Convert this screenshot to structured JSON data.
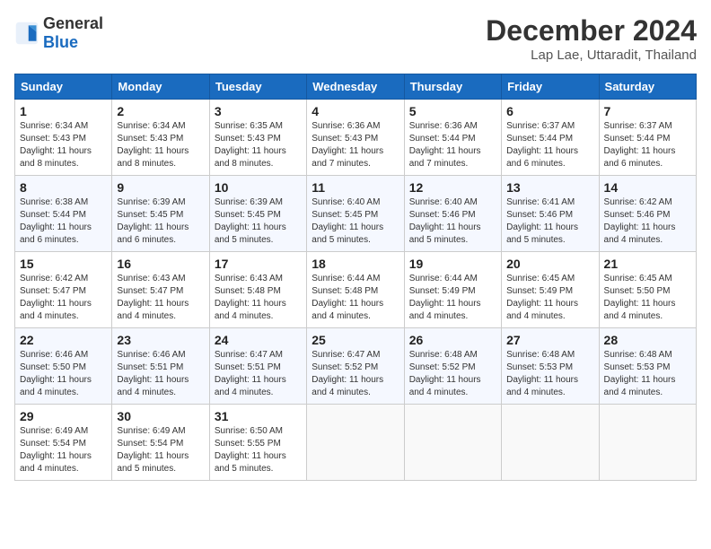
{
  "header": {
    "logo_general": "General",
    "logo_blue": "Blue",
    "month_title": "December 2024",
    "location": "Lap Lae, Uttaradit, Thailand"
  },
  "days_of_week": [
    "Sunday",
    "Monday",
    "Tuesday",
    "Wednesday",
    "Thursday",
    "Friday",
    "Saturday"
  ],
  "weeks": [
    [
      {
        "day": "1",
        "sunrise": "6:34 AM",
        "sunset": "5:43 PM",
        "daylight": "11 hours and 8 minutes."
      },
      {
        "day": "2",
        "sunrise": "6:34 AM",
        "sunset": "5:43 PM",
        "daylight": "11 hours and 8 minutes."
      },
      {
        "day": "3",
        "sunrise": "6:35 AM",
        "sunset": "5:43 PM",
        "daylight": "11 hours and 8 minutes."
      },
      {
        "day": "4",
        "sunrise": "6:36 AM",
        "sunset": "5:43 PM",
        "daylight": "11 hours and 7 minutes."
      },
      {
        "day": "5",
        "sunrise": "6:36 AM",
        "sunset": "5:44 PM",
        "daylight": "11 hours and 7 minutes."
      },
      {
        "day": "6",
        "sunrise": "6:37 AM",
        "sunset": "5:44 PM",
        "daylight": "11 hours and 6 minutes."
      },
      {
        "day": "7",
        "sunrise": "6:37 AM",
        "sunset": "5:44 PM",
        "daylight": "11 hours and 6 minutes."
      }
    ],
    [
      {
        "day": "8",
        "sunrise": "6:38 AM",
        "sunset": "5:44 PM",
        "daylight": "11 hours and 6 minutes."
      },
      {
        "day": "9",
        "sunrise": "6:39 AM",
        "sunset": "5:45 PM",
        "daylight": "11 hours and 6 minutes."
      },
      {
        "day": "10",
        "sunrise": "6:39 AM",
        "sunset": "5:45 PM",
        "daylight": "11 hours and 5 minutes."
      },
      {
        "day": "11",
        "sunrise": "6:40 AM",
        "sunset": "5:45 PM",
        "daylight": "11 hours and 5 minutes."
      },
      {
        "day": "12",
        "sunrise": "6:40 AM",
        "sunset": "5:46 PM",
        "daylight": "11 hours and 5 minutes."
      },
      {
        "day": "13",
        "sunrise": "6:41 AM",
        "sunset": "5:46 PM",
        "daylight": "11 hours and 5 minutes."
      },
      {
        "day": "14",
        "sunrise": "6:42 AM",
        "sunset": "5:46 PM",
        "daylight": "11 hours and 4 minutes."
      }
    ],
    [
      {
        "day": "15",
        "sunrise": "6:42 AM",
        "sunset": "5:47 PM",
        "daylight": "11 hours and 4 minutes."
      },
      {
        "day": "16",
        "sunrise": "6:43 AM",
        "sunset": "5:47 PM",
        "daylight": "11 hours and 4 minutes."
      },
      {
        "day": "17",
        "sunrise": "6:43 AM",
        "sunset": "5:48 PM",
        "daylight": "11 hours and 4 minutes."
      },
      {
        "day": "18",
        "sunrise": "6:44 AM",
        "sunset": "5:48 PM",
        "daylight": "11 hours and 4 minutes."
      },
      {
        "day": "19",
        "sunrise": "6:44 AM",
        "sunset": "5:49 PM",
        "daylight": "11 hours and 4 minutes."
      },
      {
        "day": "20",
        "sunrise": "6:45 AM",
        "sunset": "5:49 PM",
        "daylight": "11 hours and 4 minutes."
      },
      {
        "day": "21",
        "sunrise": "6:45 AM",
        "sunset": "5:50 PM",
        "daylight": "11 hours and 4 minutes."
      }
    ],
    [
      {
        "day": "22",
        "sunrise": "6:46 AM",
        "sunset": "5:50 PM",
        "daylight": "11 hours and 4 minutes."
      },
      {
        "day": "23",
        "sunrise": "6:46 AM",
        "sunset": "5:51 PM",
        "daylight": "11 hours and 4 minutes."
      },
      {
        "day": "24",
        "sunrise": "6:47 AM",
        "sunset": "5:51 PM",
        "daylight": "11 hours and 4 minutes."
      },
      {
        "day": "25",
        "sunrise": "6:47 AM",
        "sunset": "5:52 PM",
        "daylight": "11 hours and 4 minutes."
      },
      {
        "day": "26",
        "sunrise": "6:48 AM",
        "sunset": "5:52 PM",
        "daylight": "11 hours and 4 minutes."
      },
      {
        "day": "27",
        "sunrise": "6:48 AM",
        "sunset": "5:53 PM",
        "daylight": "11 hours and 4 minutes."
      },
      {
        "day": "28",
        "sunrise": "6:48 AM",
        "sunset": "5:53 PM",
        "daylight": "11 hours and 4 minutes."
      }
    ],
    [
      {
        "day": "29",
        "sunrise": "6:49 AM",
        "sunset": "5:54 PM",
        "daylight": "11 hours and 4 minutes."
      },
      {
        "day": "30",
        "sunrise": "6:49 AM",
        "sunset": "5:54 PM",
        "daylight": "11 hours and 5 minutes."
      },
      {
        "day": "31",
        "sunrise": "6:50 AM",
        "sunset": "5:55 PM",
        "daylight": "11 hours and 5 minutes."
      },
      null,
      null,
      null,
      null
    ]
  ]
}
